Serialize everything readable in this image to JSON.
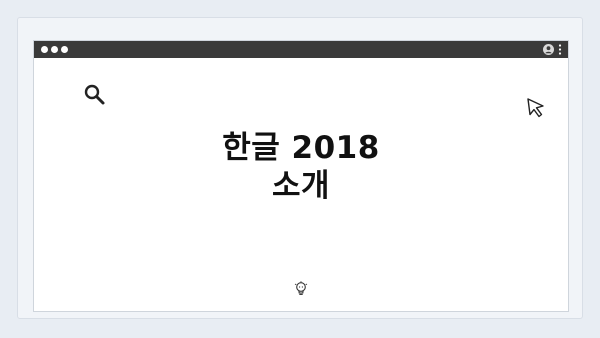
{
  "window": {
    "title_line_1": "한글 2018",
    "title_line_2": "소개"
  },
  "icons": {
    "top_indicator": "pagination-dots",
    "traffic_lights": "window-control-dots",
    "user": "user-icon",
    "menu": "more-vertical-icon",
    "search": "search-icon",
    "cursor": "cursor-pointer-icon",
    "lightbulb": "lightbulb-icon"
  },
  "colors": {
    "background": "#e8edf3",
    "titlebar": "#3a3a3a",
    "content": "#ffffff",
    "text": "#111111"
  }
}
